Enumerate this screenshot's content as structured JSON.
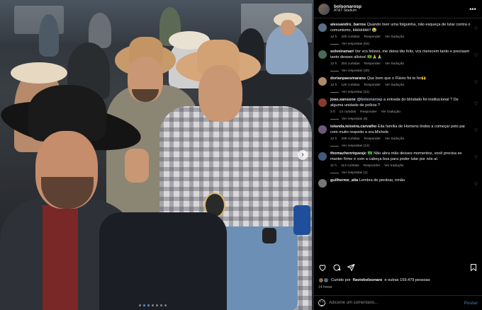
{
  "post": {
    "username": "bolsonarosp",
    "location": "AT&T Stadium",
    "carousel_dots": 7,
    "active_dot": 1
  },
  "comments": [
    {
      "user": "alessandro_barros",
      "text": "Quando tiver uma folguinha, não esqueça de lutar contra o comunismo, kkkkkkkk!! 😂",
      "time": "12 h",
      "likes": "220 curtidas",
      "reply": "Responder",
      "translate": "Ver tradução",
      "replies": "Ver respostas (52)",
      "avatar_color": "#5b6f86"
    },
    {
      "user": "solveiramari",
      "text": "Ver vcs felizes, me deixa tão feliz, vcs merecem tanto e precisam tanto desses alívios! 🇧🇷🙏🙏",
      "time": "12 h",
      "likes": "204 curtidas",
      "reply": "Responder",
      "translate": "Ver tradução",
      "replies": "Ver respostas (30)",
      "avatar_color": "#4a6a5a"
    },
    {
      "user": "dorianpaesmarano",
      "text": "Que bom que o Flávio foi te fer🙌",
      "time": "12 h",
      "likes": "126 curtidas",
      "reply": "Responder",
      "translate": "Ver tradução",
      "replies": "Ver respostas (21)",
      "avatar_color": "#b08b6a"
    },
    {
      "user": "joao.sansone",
      "mention": "@bolsonarosp",
      "text": "a entrada do blindado foi institucional ? De alguma unidade de polícia ?",
      "time": "3 h",
      "likes": "14 curtidas",
      "reply": "Responder",
      "translate": "Ver tradução",
      "replies": "Ver respostas (5)",
      "avatar_color": "#8a3b2f"
    },
    {
      "user": "iolanda.teixeira.carvalho",
      "text": "Eita família de Homens lindos a começar pelo pai com muito respeito a sra.Michele",
      "time": "12 h",
      "likes": "339 curtidas",
      "reply": "Responder",
      "translate": "Ver tradução",
      "replies": "Ver respostas (12)",
      "avatar_color": "#6f5a7a"
    },
    {
      "user": "thomazhenriquesjc",
      "text": "🇧🇷 Não abra mão desses momentos, você precisa se manter firme e com a cabeça boa para poder lutar por nós aí.",
      "time": "11 h",
      "likes": "113 curtidas",
      "reply": "Responder",
      "translate": "Ver tradução",
      "replies": "Ver respostas (1)",
      "avatar_color": "#3f5a7d"
    },
    {
      "user": "guilherme_alia",
      "text": "Lembra de perdoar, irmão",
      "time": "",
      "likes": "",
      "reply": "",
      "translate": "",
      "replies": "",
      "avatar_color": "#777777"
    }
  ],
  "likes_line": {
    "prefix": "Curtido por",
    "user": "flaviobolsonaro",
    "suffix": "e outras 159.479 pessoas"
  },
  "time_ago": "14 horas",
  "add_comment": {
    "placeholder": "Adicione um comentário...",
    "post_label": "Postar"
  },
  "icons": {
    "more": "more-horizontal-icon",
    "like": "heart-icon",
    "comment": "comment-icon",
    "share": "send-icon",
    "save": "bookmark-icon",
    "emoji": "emoji-icon"
  },
  "colors": {
    "background": "#000000",
    "link": "#3897f0",
    "muted": "#a8a8a8",
    "post_button": "#3d5f80"
  }
}
